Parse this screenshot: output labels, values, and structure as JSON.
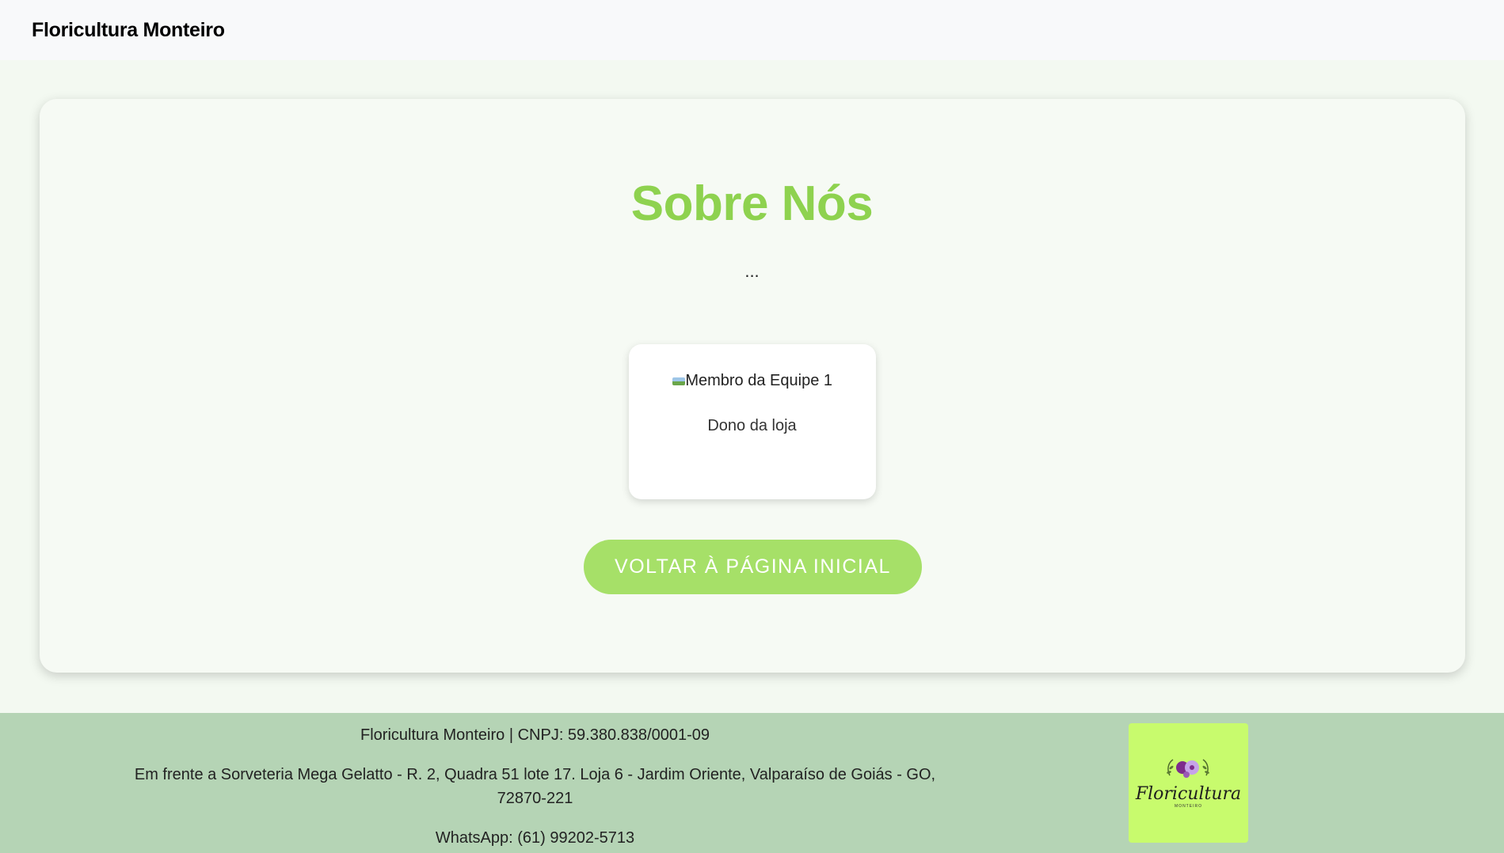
{
  "header": {
    "brand": "Floricultura Monteiro"
  },
  "main": {
    "title": "Sobre Nós",
    "subtitle": "...",
    "team": [
      {
        "image_alt": "Membro da Equipe 1",
        "role": "Dono da loja"
      }
    ],
    "back_button_label": "VOLTAR À PÁGINA INICIAL"
  },
  "footer": {
    "company_line": "Floricultura Monteiro | CNPJ: 59.380.838/0001-09",
    "address": "Em frente a Sorveteria Mega Gelatto - R. 2, Quadra 51 lote 17. Loja 6 - Jardim Oriente, Valparaíso de Goiás - GO, 72870-221",
    "whatsapp": "WhatsApp: (61) 99202-5713",
    "logo": {
      "text": "Floricultura",
      "subtext": "MONTEIRO"
    }
  },
  "colors": {
    "title": "#8ed24f",
    "button": "#a6e068",
    "footer_bg": "#b5d4b5",
    "logo_bg": "#c8fb6d",
    "page_bg": "#f3f9f1"
  }
}
